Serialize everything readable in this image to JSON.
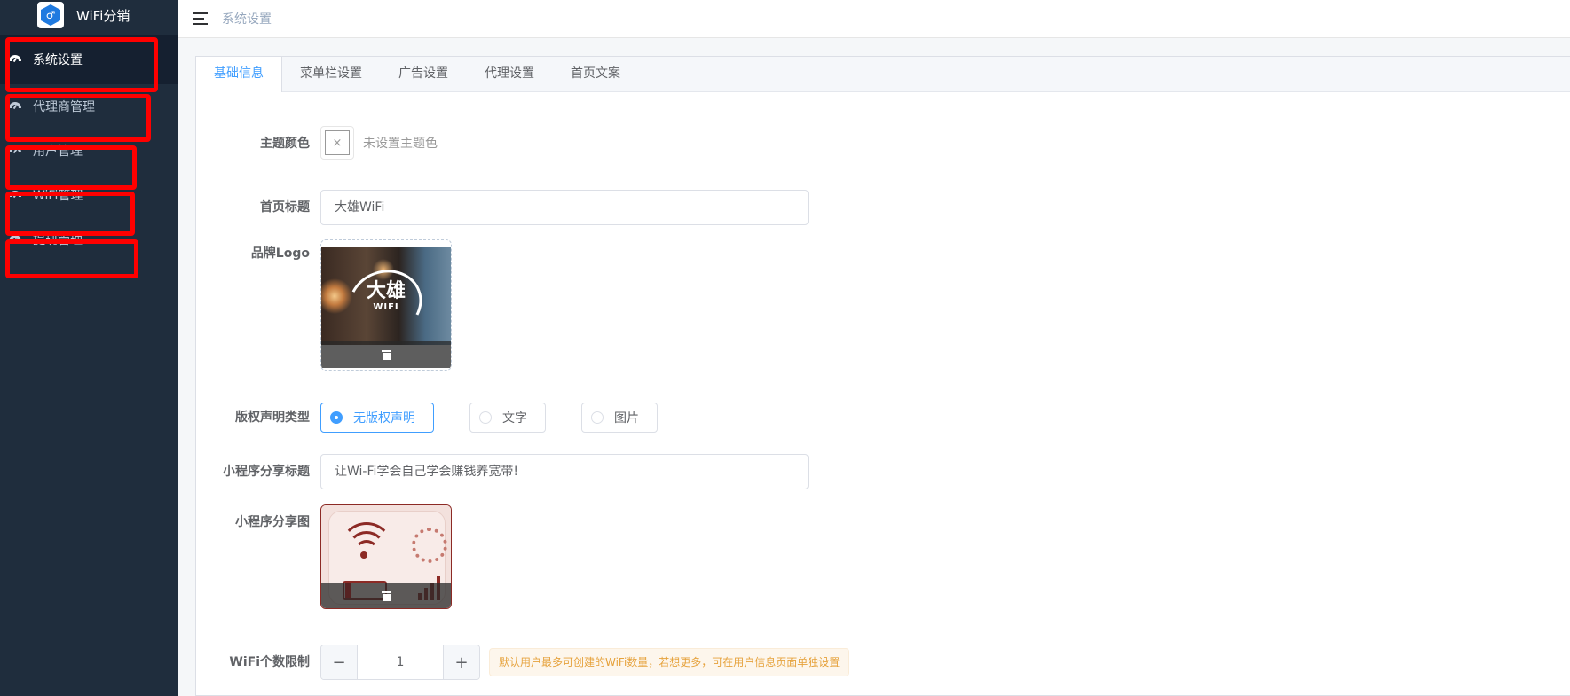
{
  "brand": {
    "title": "WiFi分销"
  },
  "sidebar": {
    "items": [
      {
        "label": "系统设置"
      },
      {
        "label": "代理商管理"
      },
      {
        "label": "用户管理"
      },
      {
        "label": "WiFi管理"
      },
      {
        "label": "提现管理"
      }
    ]
  },
  "header": {
    "breadcrumb": "系统设置"
  },
  "tabs": [
    {
      "label": "基础信息"
    },
    {
      "label": "菜单栏设置"
    },
    {
      "label": "广告设置"
    },
    {
      "label": "代理设置"
    },
    {
      "label": "首页文案"
    }
  ],
  "form": {
    "theme_color": {
      "label": "主题颜色",
      "hint": "未设置主题色",
      "clear_glyph": "×"
    },
    "home_title": {
      "label": "首页标题",
      "value": "大雄WiFi"
    },
    "brand_logo": {
      "label": "品牌Logo",
      "logo_big": "大雄",
      "logo_small": "WIFI"
    },
    "copyright_type": {
      "label": "版权声明类型",
      "options": [
        {
          "label": "无版权声明",
          "checked": true
        },
        {
          "label": "文字",
          "checked": false
        },
        {
          "label": "图片",
          "checked": false
        }
      ]
    },
    "share_title": {
      "label": "小程序分享标题",
      "value": "让Wi-Fi学会自己学会赚钱养宽带!"
    },
    "share_image": {
      "label": "小程序分享图"
    },
    "wifi_limit": {
      "label": "WiFi个数限制",
      "minus": "−",
      "value": "1",
      "plus": "+",
      "tip": "默认用户最多可创建的WiFi数量，若想更多，可在用户信息页面单独设置"
    }
  },
  "colors": {
    "accent": "#409eff",
    "sidebar_bg": "#1f2d3d",
    "highlight": "#ff0000"
  }
}
